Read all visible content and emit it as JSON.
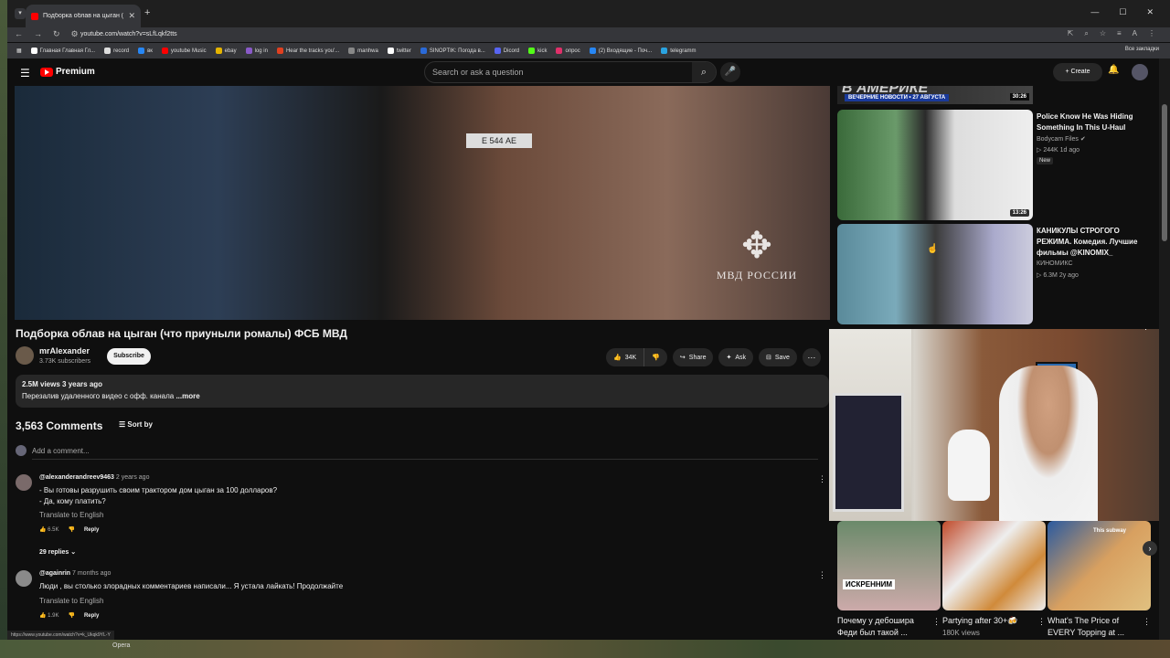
{
  "browser": {
    "tab_title": "Подборка облав на цыган (ч",
    "url": "youtube.com/watch?v=sLfLqkf2tts",
    "status_url": "https://www.youtube.com/watch?v=k_Ukqk9YL-Y",
    "bookmarks": [
      "Главная Главная Гл...",
      "record",
      "вк",
      "youtube Music",
      "ebay",
      "log in",
      "Hear the tracks you'...",
      "manhwa",
      "twitter",
      "SINOPTIK: Погода в...",
      "Dicord",
      "kick",
      "опрос",
      "(2) Входящие - Поч...",
      "telegramm"
    ],
    "bookmarks_all": "Все закладки",
    "taskbar_label": "Opera"
  },
  "header": {
    "logo": "Premium",
    "search_placeholder": "Search or ask a question",
    "create": "Create"
  },
  "video": {
    "plate": "Е 544 АЕ",
    "watermark": "МВД РОССИИ",
    "title": "Подборка облав на цыган (что приуныли ромалы) ФСБ МВД",
    "channel": "mrAlexander",
    "subscribers": "3.73K subscribers",
    "subscribe": "Subscribe",
    "likes": "34K",
    "share": "Share",
    "ask": "Ask",
    "save": "Save",
    "stats": "2.5M views  3 years ago",
    "description": "Перезалив удаленного видео с офф. канала",
    "more": "...more"
  },
  "comments": {
    "count": "3,563 Comments",
    "sort": "Sort by",
    "add_placeholder": "Add a comment...",
    "items": [
      {
        "author": "@alexanderandreev9463",
        "time": "2 years ago",
        "line1": "- Вы готовы разрушить своим трактором дом цыган за 100 долларов?",
        "line2": "- Да, кому платить?",
        "translate": "Translate to English",
        "likes": "6.5K",
        "reply": "Reply",
        "replies": "29 replies"
      },
      {
        "author": "@againrin",
        "time": "7 months ago",
        "line1": "Люди , вы столько злорадных комментариев написали... Я устала лайкать! Продолжайте",
        "translate": "Translate to English",
        "likes": "1.9K",
        "reply": "Reply"
      }
    ]
  },
  "recommendations": {
    "top_strip": {
      "headline": "В АМЕРИКЕ",
      "sub": "ВЕЧЕРНИЕ НОВОСТИ • 27 АВГУСТА",
      "duration": "30:26"
    },
    "items": [
      {
        "title": "Police Know He Was Hiding Something In This U-Haul",
        "channel": "Bodycam Files",
        "meta": "244K  1d ago",
        "badge": "New",
        "duration": "13:26"
      },
      {
        "title": "КАНИКУЛЫ СТРОГОГО РЕЖИМА. Комедия. Лучшие фильмы @KINOMIX_",
        "channel": "КИНОМИКС",
        "meta": "6.3M  2y ago"
      }
    ]
  },
  "shorts": [
    {
      "title": "Почему у дебошира Феди был такой ...",
      "caption": "ИСКРЕННИМ"
    },
    {
      "title": "Partying after 30+🍻",
      "meta": "180K views"
    },
    {
      "title": "What's The Price of EVERY Topping at ...",
      "caption": "This subway"
    }
  ],
  "colors": {
    "yt_red": "#ff0000",
    "link_blue": "#3ea6ff",
    "bg": "#0f0f0f"
  }
}
